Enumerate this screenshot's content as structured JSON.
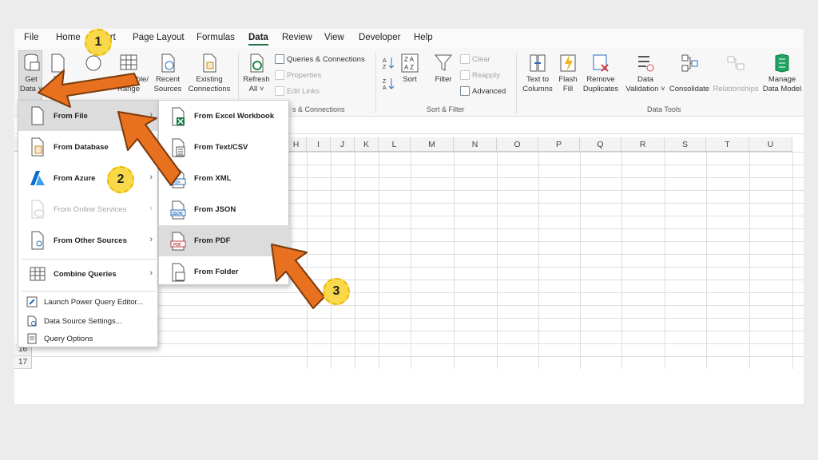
{
  "menu_tabs": [
    "File",
    "Home",
    "Insert",
    "Page Layout",
    "Formulas",
    "Data",
    "Review",
    "View",
    "Developer",
    "Help"
  ],
  "active_tab": "Data",
  "ribbon": {
    "get_data": "Get",
    "get_data_2": "Data ˅",
    "from_text": "Te",
    "from_web": "Web",
    "from_table": "From Table/",
    "from_table_2": "Range",
    "recent_sources": "Recent",
    "recent_sources_2": "Sources",
    "existing_connections": "Existing",
    "existing_connections_2": "Connections",
    "refresh_all": "Refresh",
    "refresh_all_2": "All ˅",
    "queries_connections": "Queries & Connections",
    "properties": "Properties",
    "edit_links": "Edit Links",
    "group_queries": "s & Connections",
    "sort": "Sort",
    "filter": "Filter",
    "clear": "Clear",
    "reapply": "Reapply",
    "advanced": "Advanced",
    "group_sort_filter": "Sort & Filter",
    "text_to_columns": "Text to",
    "text_to_columns_2": "Columns",
    "flash_fill": "Flash",
    "flash_fill_2": "Fill",
    "remove_duplicates": "Remove",
    "remove_duplicates_2": "Duplicates",
    "data_validation": "Data",
    "data_validation_2": "Validation ˅",
    "consolidate": "Consolidate",
    "relationships": "Relationships",
    "manage_data_model": "Manage",
    "manage_data_model_2": "Data Model",
    "group_data_tools": "Data Tools"
  },
  "columns": [
    "H",
    "I",
    "J",
    "K",
    "L",
    "M",
    "N",
    "O",
    "P",
    "Q",
    "R",
    "S",
    "T",
    "U"
  ],
  "rows": [
    "16",
    "17"
  ],
  "dropdown": {
    "from_file": "From File",
    "from_database": "From Database",
    "from_azure": "From Azure",
    "from_online_services": "From Online Services",
    "from_other_sources": "From Other Sources",
    "combine_queries": "Combine Queries",
    "launch_pq_editor": "Launch Power Query Editor...",
    "data_source_settings": "Data Source Settings...",
    "query_options": "Query Options"
  },
  "submenu": {
    "from_excel_workbook": "From Excel Workbook",
    "from_text_csv": "From Text/CSV",
    "from_xml": "From XML",
    "from_json": "From JSON",
    "from_pdf": "From PDF",
    "from_folder": "From Folder"
  },
  "annotations": [
    "1",
    "2",
    "3"
  ],
  "colors": {
    "accent": "#217346",
    "arrow": "#e8711f",
    "badge": "#f9d84a"
  }
}
